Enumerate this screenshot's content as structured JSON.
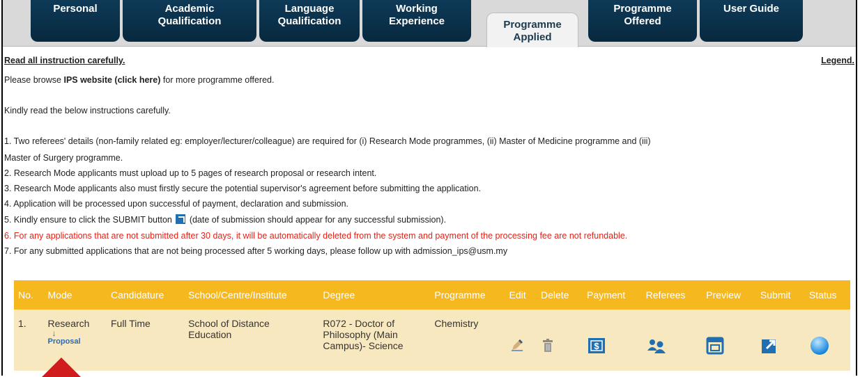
{
  "tabs": [
    {
      "label_1": "Personal",
      "label_2": ""
    },
    {
      "label_1": "Academic",
      "label_2": "Qualification"
    },
    {
      "label_1": "Language",
      "label_2": "Qualification"
    },
    {
      "label_1": "Working",
      "label_2": "Experience"
    },
    {
      "label_1": "Programme",
      "label_2": "Applied"
    },
    {
      "label_1": "Programme",
      "label_2": "Offered"
    },
    {
      "label_1": "User Guide",
      "label_2": ""
    }
  ],
  "instructions_link": "Read all instruction carefully.",
  "legend_link": "Legend.",
  "browse_prefix": "Please browse ",
  "browse_link": "IPS website (click here)",
  "browse_suffix": " for more programme offered.",
  "kindly_read": "Kindly read the below instructions carefully.",
  "items": [
    "1. Two referees' details (non-family related eg: employer/lecturer/colleague) are required for (i) Research Mode programmes, (ii) Master of Medicine programme and (iii)",
    "Master of Surgery programme.",
    "2. Research Mode applicants must upload up to 5 pages of research proposal or research intent.",
    "3. Research Mode applicants also must firstly secure the potential supervisor's agreement before submitting the application.",
    "4. Application will be processed upon successful of payment, declaration and submission.",
    "5. Kindly ensure to click the SUBMIT button",
    " (date of submission should appear for any successful submission).",
    "6. For any applications that are not submitted after 30 days, it will be automatically deleted from the system and payment of the processing fee are not refundable.",
    "7. For any submitted applications that are not being processed after 5 working days, please follow up with admission_ips@usm.my"
  ],
  "table": {
    "headers": [
      "No.",
      "Mode",
      "Candidature",
      "School/Centre/Institute",
      "Degree",
      "Programme",
      "Edit",
      "Delete",
      "Payment",
      "Referees",
      "Preview",
      "Submit",
      "Status"
    ],
    "row": {
      "no": "1.",
      "mode": "Research",
      "proposal": "Proposal",
      "candidature": "Full Time",
      "school_1": "School of Distance",
      "school_2": "Education",
      "degree_1": "R072 - Doctor of",
      "degree_2": "Philosophy (Main",
      "degree_3": "Campus)- Science",
      "programme": "Chemistry"
    }
  },
  "icons": {
    "edit": "pencil-icon",
    "delete": "trash-icon",
    "payment": "payment-icon",
    "referees": "users-icon",
    "preview": "preview-icon",
    "submit": "external-link-icon",
    "status": "status-dot-icon",
    "accent": "#f6b81f",
    "submit_color": "#1f6fb2"
  }
}
